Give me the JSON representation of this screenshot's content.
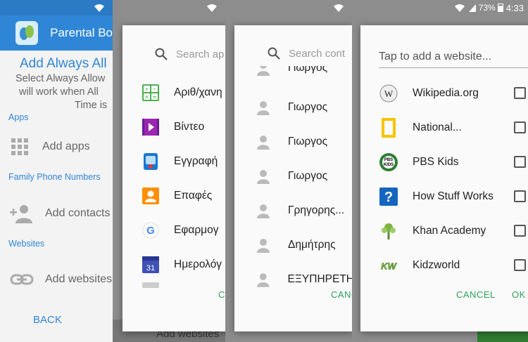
{
  "status": {
    "battery": "73%",
    "time": "4:33"
  },
  "app": {
    "title": "Parental Bo",
    "heading": "Add Always All",
    "description": [
      "Select Always Allow",
      "will work when All",
      "Time is"
    ],
    "sections": {
      "apps": "Apps",
      "phones": "Family Phone Numbers",
      "websites": "Websites"
    },
    "add_apps": "Add apps",
    "add_contacts": "Add contacts",
    "add_websites": "Add websites",
    "back": "BACK"
  },
  "apps_dialog": {
    "search_placeholder": "Search ap",
    "items": [
      {
        "label": "Αριθ/χανη",
        "icon": "calculator-icon"
      },
      {
        "label": "Βίντεο",
        "icon": "video-icon"
      },
      {
        "label": "Εγγραφή",
        "icon": "voice-recorder-icon"
      },
      {
        "label": "Επαφές",
        "icon": "contacts-icon"
      },
      {
        "label": "Εφαρμογ",
        "icon": "google-icon"
      },
      {
        "label": "Ημερολόγ",
        "icon": "calendar-icon"
      }
    ],
    "cancel": "CA",
    "peek_label": "Add websites"
  },
  "contacts_dialog": {
    "search_placeholder": "Search cont",
    "items": [
      "Γιωργος",
      "Γιωργος",
      "Γιωργος",
      "Γιωργος",
      "Γρηγορης...",
      "Δημήτρης",
      "ΕΞΥΠΗΡΕΤΗ"
    ],
    "cancel": "CANC"
  },
  "websites_dialog": {
    "placeholder": "Tap to add a website...",
    "items": [
      {
        "label": "Wikipedia.org",
        "icon": "wikipedia-icon"
      },
      {
        "label": "National...",
        "icon": "national-geographic-icon"
      },
      {
        "label": "PBS Kids",
        "icon": "pbs-kids-icon"
      },
      {
        "label": "How Stuff Works",
        "icon": "how-stuff-works-icon"
      },
      {
        "label": "Khan Academy",
        "icon": "khan-academy-icon"
      },
      {
        "label": "Kidzworld",
        "icon": "kidzworld-icon"
      }
    ],
    "cancel": "CANCEL",
    "ok": "OK"
  },
  "colors": {
    "accent": "#2f86d6",
    "button": "#2ca05a"
  }
}
